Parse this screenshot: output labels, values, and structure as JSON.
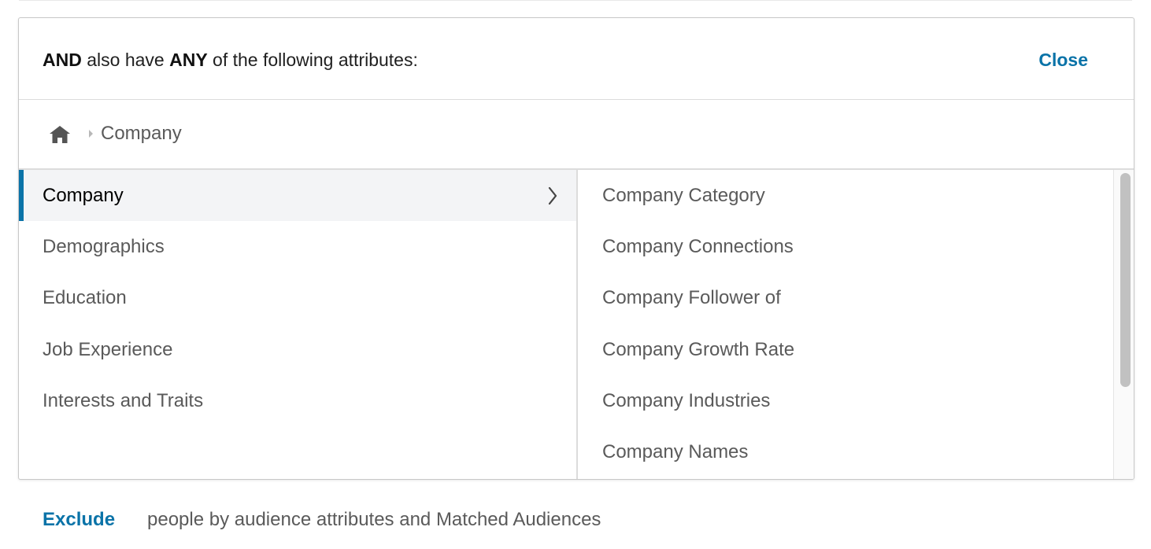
{
  "colors": {
    "link": "#0a73a8",
    "active_indicator": "#0a73a8",
    "muted_text": "#5a5a5a",
    "active_bg": "#f3f4f6"
  },
  "header": {
    "text_and": "AND",
    "text_mid": " also have ",
    "text_any": "ANY",
    "text_tail": " of the following attributes:",
    "close_label": "Close"
  },
  "breadcrumb": {
    "home_icon": "home-icon",
    "separator_icon": "chevron-right-icon",
    "current": "Company"
  },
  "categories": {
    "selected": "Company",
    "items": [
      {
        "label": "Company",
        "active": true
      },
      {
        "label": "Demographics",
        "active": false
      },
      {
        "label": "Education",
        "active": false
      },
      {
        "label": "Job Experience",
        "active": false
      },
      {
        "label": "Interests and Traits",
        "active": false
      }
    ]
  },
  "subcategories": {
    "items": [
      {
        "label": "Company Category"
      },
      {
        "label": "Company Connections"
      },
      {
        "label": "Company Follower of"
      },
      {
        "label": "Company Growth Rate"
      },
      {
        "label": "Company Industries"
      },
      {
        "label": "Company Names"
      }
    ]
  },
  "footer": {
    "exclude_label": "Exclude",
    "exclude_text": "people by audience attributes and Matched Audiences"
  }
}
